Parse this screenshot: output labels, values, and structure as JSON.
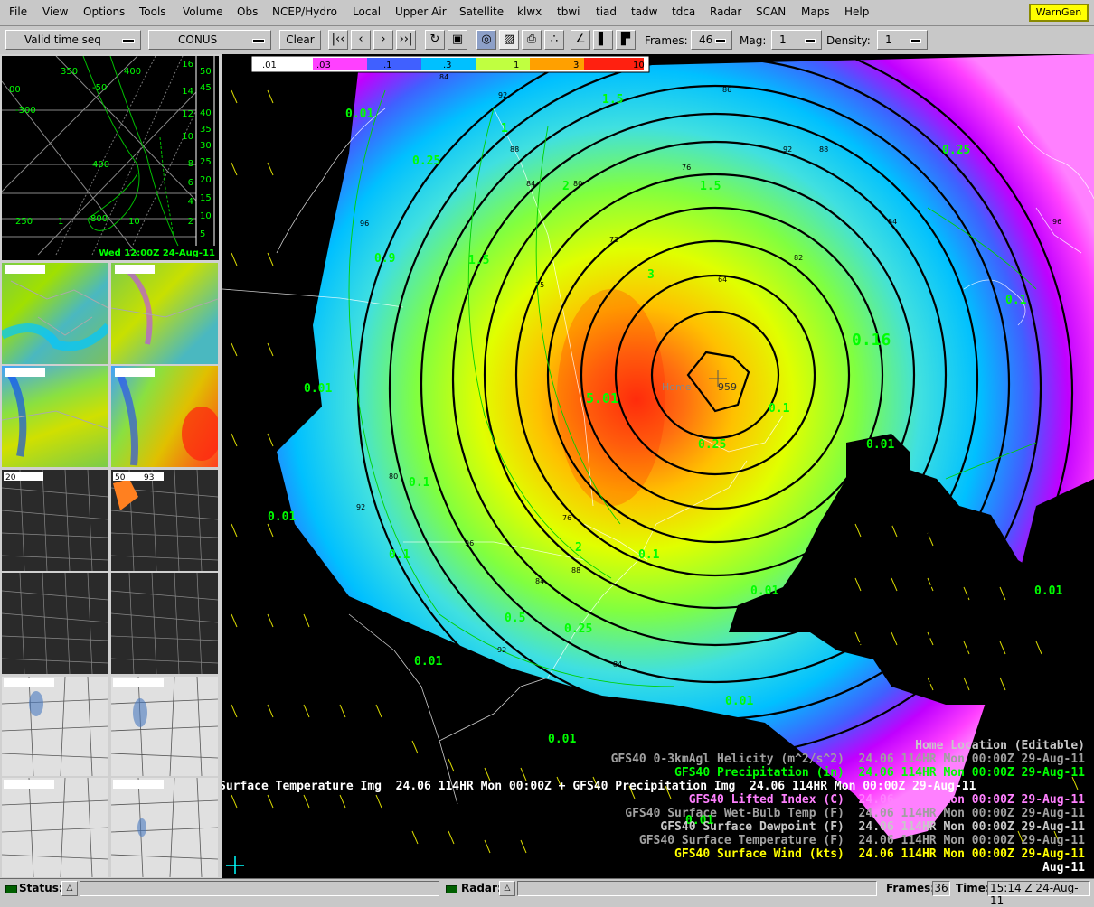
{
  "menus": [
    "File",
    "View",
    "Options",
    "Tools",
    "Volume",
    "Obs",
    "NCEP/Hydro",
    "Local",
    "Upper Air",
    "Satellite",
    "klwx",
    "tbwi",
    "tiad",
    "tadw",
    "tdca",
    "Radar",
    "SCAN",
    "Maps",
    "Help"
  ],
  "warngen_label": "WarnGen",
  "toolbar": {
    "time_mode": "Valid time seq",
    "scale": "CONUS",
    "clear": "Clear",
    "frames_label": "Frames:",
    "frames_value": "46",
    "mag_label": "Mag:",
    "mag_value": "1",
    "density_label": "Density:",
    "density_value": "1"
  },
  "skewt": {
    "iso_labels": [
      "350",
      "400",
      "-50",
      "-300",
      "00",
      "400",
      "250",
      "1",
      "800",
      "10"
    ],
    "right_scale_inner": [
      "16",
      "14",
      "12",
      "10",
      "8",
      "6",
      "4",
      "2"
    ],
    "right_scale_outer": [
      "50",
      "45",
      "40",
      "35",
      "30",
      "25",
      "20",
      "15",
      "10",
      "5"
    ],
    "time_label": "Wed 12:00Z 24-Aug-11"
  },
  "colorbar": {
    "ticks": [
      ".01",
      ".03",
      ".1",
      ".3",
      "1",
      "3",
      "10"
    ]
  },
  "map": {
    "center_label": "959",
    "home_label": "Home",
    "green_labels": [
      "0.01",
      "0.25",
      "1.5",
      "1",
      "2",
      "1.5",
      "0.25",
      "0.9",
      "1.5",
      "3",
      "0.1",
      "0.16",
      "0.01",
      "0.1",
      "5.01",
      "0.25",
      "0.01",
      "0.01",
      "0.1",
      "0.1",
      "2",
      "0.1",
      "0.01",
      "0.01",
      "0.5",
      "0.25",
      "0.01",
      "0.01",
      "0.01",
      "0.01"
    ],
    "black_labels": [
      "84",
      "92",
      "88",
      "86",
      "84",
      "80",
      "76",
      "72",
      "75",
      "96",
      "64",
      "82",
      "96",
      "92",
      "88",
      "84",
      "80",
      "76",
      "92",
      "96",
      "88",
      "84",
      "92",
      "84",
      "92"
    ]
  },
  "legend": {
    "lines": [
      {
        "text": "Home Location (Editable)",
        "color": "#c8c8c8"
      },
      {
        "text": "GFS40 0-3kmAgl Helicity (m^2/s^2)  24.06 114HR Mon 00:00Z 29-Aug-11",
        "color": "#a0a0a0"
      },
      {
        "text": "GFS40 Precipitation (in)  24.06 114HR Mon 00:00Z 29-Aug-11",
        "color": "#00ff00"
      },
      {
        "text": "Surface Temperature Img  24.06 114HR Mon 00:00Z + GFS40 Precipitation Img  24.06 114HR Mon 00:00Z 29-Aug-11",
        "color": "#ffffff"
      },
      {
        "text": "GFS40 Lifted Index (C)  24.06 114HR Mon 00:00Z 29-Aug-11",
        "color": "#ff80ff"
      },
      {
        "text": "GFS40 Surface Wet-Bulb Temp (F)  24.06 114HR Mon 00:00Z 29-Aug-11",
        "color": "#a0a0a0"
      },
      {
        "text": "GFS40 Surface Dewpoint (F)  24.06 114HR Mon 00:00Z 29-Aug-11",
        "color": "#c8c8c8"
      },
      {
        "text": "GFS40 Surface Temperature (F)  24.06 114HR Mon 00:00Z 29-Aug-11",
        "color": "#a0a0a0"
      },
      {
        "text": "GFS40 Surface Wind (kts)  24.06 114HR Mon 00:00Z 29-Aug-11",
        "color": "#ffff00"
      },
      {
        "text": "Aug-11",
        "color": "#ffffff"
      }
    ]
  },
  "status": {
    "status_label": "Status:",
    "radar_label": "Radar:",
    "frames_label": "Frames:",
    "frames_value": "36",
    "time_label": "Time:",
    "time_value": "15:14 Z 24-Aug-11"
  },
  "thumbnails": {
    "legend_a": "20",
    "legend_b": "60",
    "legend_c": "50",
    "legend_d": "93"
  }
}
